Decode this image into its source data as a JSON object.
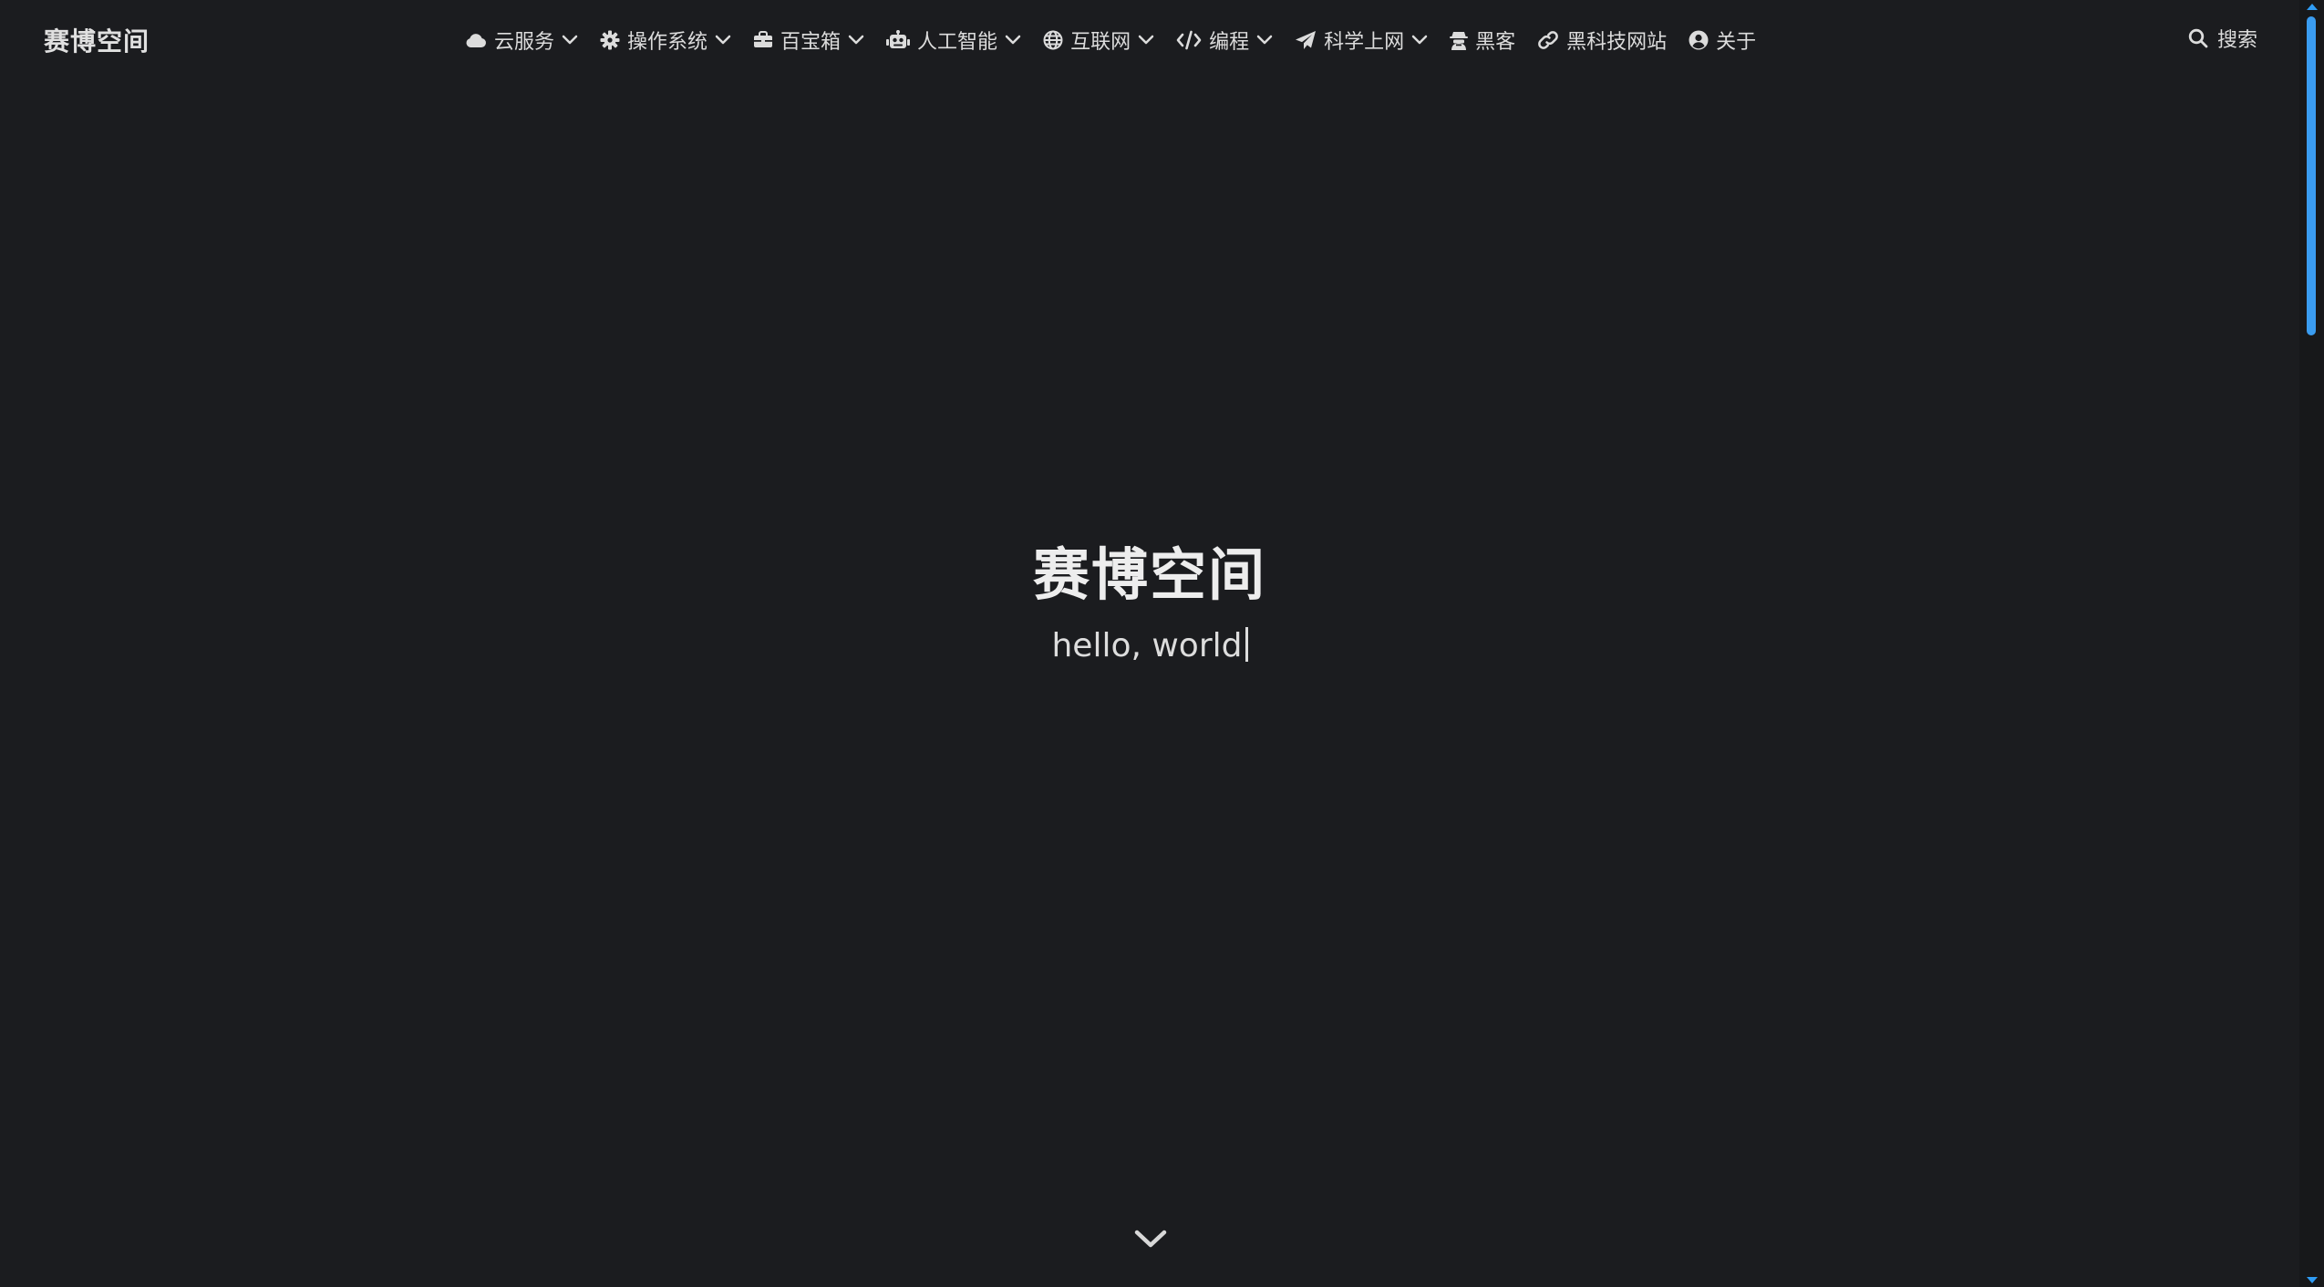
{
  "navbar": {
    "brand": "赛博空间",
    "menu": [
      {
        "label": "云服务",
        "icon": "cloud-icon",
        "dropdown": true
      },
      {
        "label": "操作系统",
        "icon": "gear-icon",
        "dropdown": true
      },
      {
        "label": "百宝箱",
        "icon": "toolbox-icon",
        "dropdown": true
      },
      {
        "label": "人工智能",
        "icon": "robot-icon",
        "dropdown": true
      },
      {
        "label": "互联网",
        "icon": "globe-icon",
        "dropdown": true
      },
      {
        "label": "编程",
        "icon": "code-icon",
        "dropdown": true
      },
      {
        "label": "科学上网",
        "icon": "paper-plane-icon",
        "dropdown": true
      },
      {
        "label": "黑客",
        "icon": "hacker-icon",
        "dropdown": false
      },
      {
        "label": "黑科技网站",
        "icon": "link-icon",
        "dropdown": false
      },
      {
        "label": "关于",
        "icon": "user-circle-icon",
        "dropdown": false
      }
    ],
    "search_label": "搜索",
    "search_icon": "search-icon"
  },
  "hero": {
    "title": "赛博空间",
    "subtitle": "hello, world"
  },
  "scroll_down_icon": "chevron-down-icon",
  "colors": {
    "background": "#1b1c1f",
    "text": "#e6e6e6",
    "scrollbar_accent": "#3a9cf0"
  }
}
